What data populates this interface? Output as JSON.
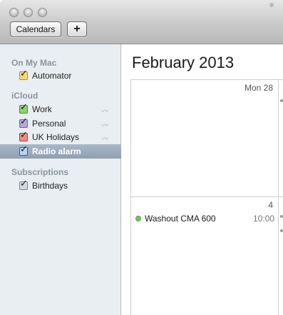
{
  "toolbar": {
    "calendars_label": "Calendars",
    "add_label": "+"
  },
  "sidebar": {
    "groups": [
      {
        "header": "On My Mac",
        "items": [
          {
            "label": "Automator",
            "checked": true,
            "color": "#e6c64a",
            "selected": false
          }
        ]
      },
      {
        "header": "iCloud",
        "items": [
          {
            "label": "Work",
            "checked": true,
            "color": "#63b043",
            "shared_icon": "broadcast-icon"
          },
          {
            "label": "Personal",
            "checked": true,
            "color": "#8c79c7",
            "shared_icon": "broadcast-icon"
          },
          {
            "label": "UK Holidays",
            "checked": true,
            "color": "#d6504a",
            "shared_icon": "broadcast-icon"
          },
          {
            "label": "Radio alarm",
            "checked": true,
            "color": "#5b8cc9",
            "selected": true
          }
        ]
      },
      {
        "header": "Subscriptions",
        "items": [
          {
            "label": "Birthdays",
            "checked": true,
            "color": "#9aa4ad"
          }
        ]
      }
    ]
  },
  "calendar": {
    "month_title": "February 2013",
    "cells": [
      {
        "day_label": "Mon 28",
        "events": []
      },
      {
        "day_label": "4",
        "events": [
          {
            "title": "Washout CMA 600",
            "time": "10:00",
            "color": "#7cc35c"
          }
        ]
      }
    ]
  },
  "colors": {
    "selection": "#97a8ba",
    "sidebar_bg": "#e9eef2"
  }
}
